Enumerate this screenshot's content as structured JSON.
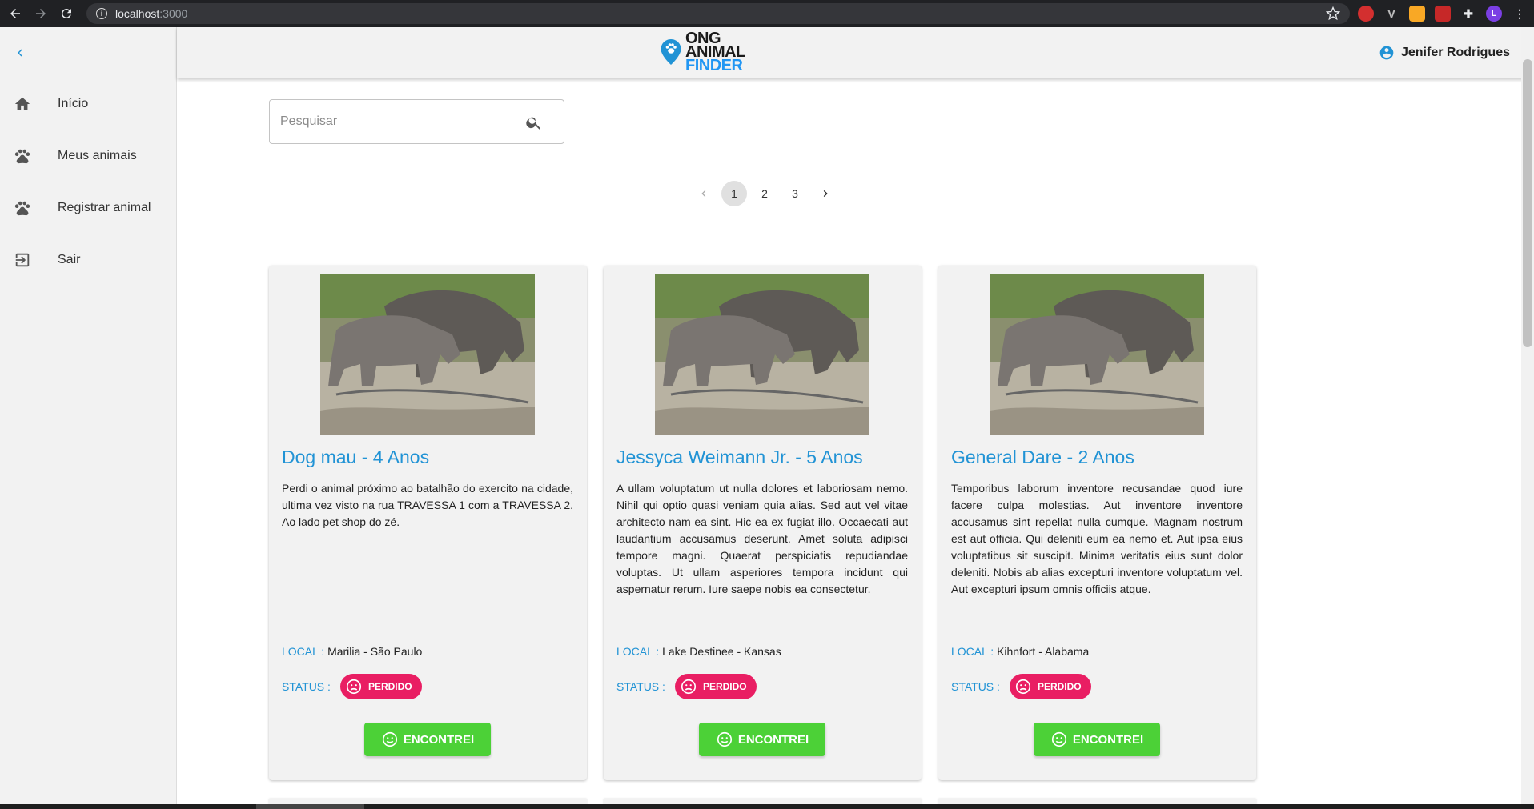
{
  "browser": {
    "url_host": "localhost",
    "url_port": ":3000"
  },
  "sidebar": {
    "items": [
      {
        "label": "Início",
        "icon": "home-icon"
      },
      {
        "label": "Meus animais",
        "icon": "paw-icon"
      },
      {
        "label": "Registrar animal",
        "icon": "paw-icon"
      },
      {
        "label": "Sair",
        "icon": "logout-icon"
      }
    ]
  },
  "header": {
    "logo_line1": "ONG",
    "logo_line2": "ANIMAL",
    "logo_line3": "FINDER",
    "user_name": "Jenifer Rodrigues"
  },
  "search": {
    "placeholder": "Pesquisar"
  },
  "pagination": {
    "pages": [
      "1",
      "2",
      "3"
    ],
    "current": "1"
  },
  "cards": [
    {
      "title": "Dog mau - 4 Anos",
      "description": "Perdi o animal próximo ao batalhão do exercito na cidade, ultima vez visto na rua TRAVESSA 1 com a TRAVESSA 2. Ao lado pet shop do zé.",
      "local_label": "LOCAL :",
      "local_value": "Marilia - São Paulo",
      "status_label": "STATUS :",
      "status_value": "PERDIDO",
      "button_label": "ENCONTREI"
    },
    {
      "title": "Jessyca Weimann Jr. - 5 Anos",
      "description": "A ullam voluptatum ut nulla dolores et laboriosam nemo. Nihil qui optio quasi veniam quia alias. Sed aut vel vitae architecto nam ea sint. Hic ea ex fugiat illo. Occaecati aut laudantium accusamus deserunt. Amet soluta adipisci tempore magni. Quaerat perspiciatis repudiandae voluptas. Ut ullam asperiores tempora incidunt qui aspernatur rerum. Iure saepe nobis ea consectetur.",
      "local_label": "LOCAL :",
      "local_value": "Lake Destinee - Kansas",
      "status_label": "STATUS :",
      "status_value": "PERDIDO",
      "button_label": "ENCONTREI"
    },
    {
      "title": "General Dare - 2 Anos",
      "description": "Temporibus laborum inventore recusandae quod iure facere culpa molestias. Aut inventore inventore accusamus sint repellat nulla cumque. Magnam nostrum est aut officia. Qui deleniti eum ea nemo et. Aut ipsa eius voluptatibus sit suscipit. Minima veritatis eius sunt dolor deleniti. Nobis ab alias excepturi inventore voluptatum vel. Aut excepturi ipsum omnis officiis atque.",
      "local_label": "LOCAL :",
      "local_value": "Kihnfort - Alabama",
      "status_label": "STATUS :",
      "status_value": "PERDIDO",
      "button_label": "ENCONTREI"
    }
  ],
  "colors": {
    "accent_blue": "#2193d5",
    "status_pink": "#e91e63",
    "button_green": "#4cd137",
    "surface": "#f2f2f2"
  }
}
